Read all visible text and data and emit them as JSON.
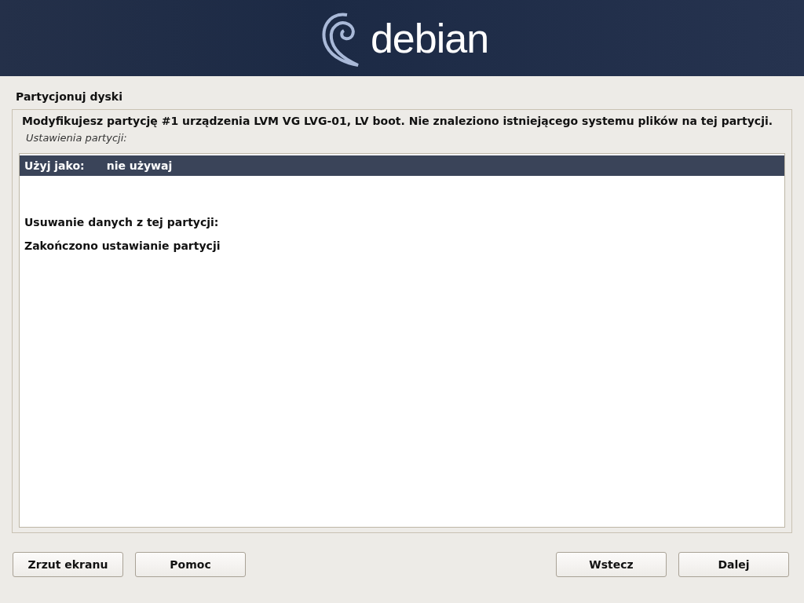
{
  "banner": {
    "logo": "debian"
  },
  "title": "Partycjonuj dyski",
  "message": "Modyfikujesz partycję #1 urządzenia LVM VG LVG-01, LV boot. Nie znaleziono istniejącego systemu plików na tej partycji.",
  "list_label": "Ustawienia partycji:",
  "items": [
    {
      "kind": "setting",
      "label": "Użyj jako:",
      "value": "nie używaj",
      "selected": true
    },
    {
      "kind": "blank",
      "selected": false
    },
    {
      "kind": "action",
      "label": "Usuwanie danych z tej partycji:",
      "selected": false
    },
    {
      "kind": "action",
      "label": "Zakończono ustawianie partycji",
      "selected": false
    }
  ],
  "buttons_left": [
    "Zrzut ekranu",
    "Pomoc"
  ],
  "buttons_right": [
    "Wstecz",
    "Dalej"
  ]
}
